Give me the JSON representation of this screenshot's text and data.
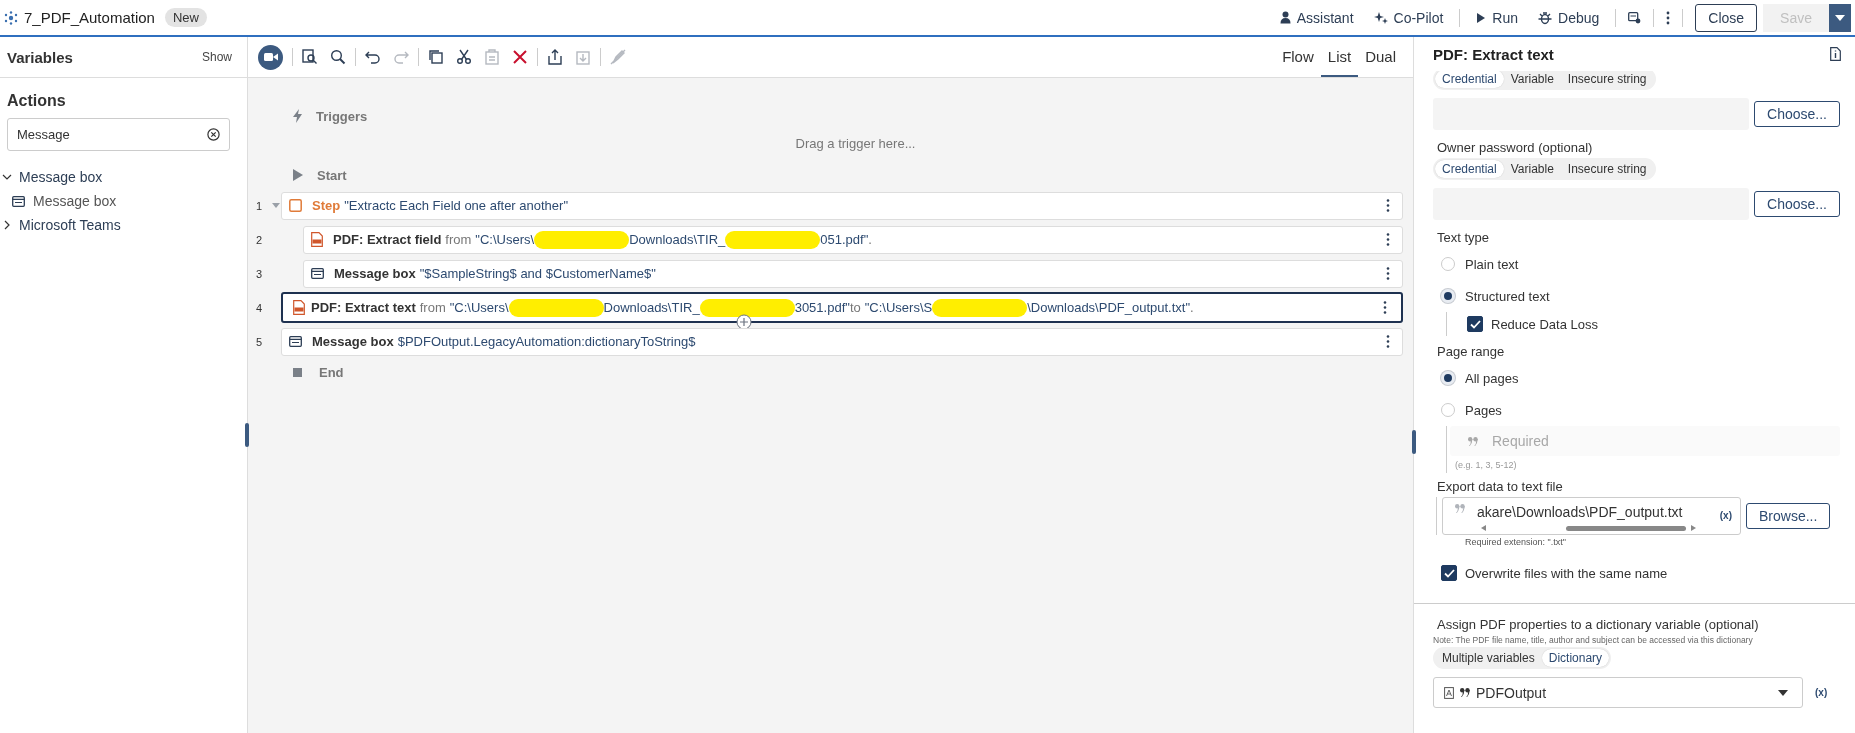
{
  "top_bar": {
    "title": "7_PDF_Automation",
    "badge": "New",
    "actions": [
      {
        "kind": "assistant",
        "label": "Assistant"
      },
      {
        "kind": "copilot",
        "label": "Co-Pilot"
      },
      {
        "kind": "run",
        "label": "Run"
      },
      {
        "kind": "debug",
        "label": "Debug"
      }
    ],
    "close": "Close",
    "save": {
      "label": "Save",
      "disabled": true
    }
  },
  "left_panel": {
    "variables": "Variables",
    "show": "Show",
    "actions_title": "Actions",
    "search": {
      "value": "Message"
    },
    "tree": [
      {
        "label": "Message box",
        "expanded": true,
        "children": [
          {
            "label": "Message box"
          }
        ]
      },
      {
        "label": "Microsoft Teams",
        "expanded": false
      }
    ]
  },
  "toolbar": {
    "tools": [
      {
        "kind": "record",
        "disabled": false
      },
      {
        "kind": "find",
        "disabled": false
      },
      {
        "kind": "search",
        "disabled": false
      },
      {
        "kind": "undo",
        "disabled": false
      },
      {
        "kind": "redo",
        "disabled": true
      },
      {
        "kind": "copy",
        "disabled": false
      },
      {
        "kind": "cut",
        "disabled": false
      },
      {
        "kind": "paste",
        "disabled": true
      },
      {
        "kind": "delete",
        "disabled": false
      },
      {
        "kind": "export",
        "disabled": false
      },
      {
        "kind": "import",
        "disabled": true
      },
      {
        "kind": "disable",
        "disabled": true
      }
    ],
    "views": [
      {
        "label": "Flow",
        "selected": false
      },
      {
        "label": "List",
        "selected": true
      },
      {
        "label": "Dual",
        "selected": false
      }
    ]
  },
  "flow": {
    "triggers": "Triggers",
    "drop_hint": "Drag a trigger here...",
    "start": "Start",
    "end": "End",
    "rows": [
      {
        "number": "1",
        "kind": "step",
        "selected": false,
        "expanded": true,
        "segments": [
          {
            "kind": "step",
            "text": "Step"
          },
          {
            "kind": "value",
            "text": "\"Extractc Each Field one after another\""
          }
        ],
        "children": [
          {
            "number": "2",
            "kind": "pdf",
            "selected": false,
            "segments": [
              {
                "kind": "name",
                "text": "PDF: Extract field"
              },
              {
                "kind": "plain",
                "text": "from"
              },
              {
                "kind": "value",
                "text": "\"C:\\Users\\"
              },
              {
                "kind": "redacted"
              },
              {
                "kind": "value",
                "text": "Downloads\\TIR_"
              },
              {
                "kind": "redacted"
              },
              {
                "kind": "value",
                "text": "051.pdf\""
              },
              {
                "kind": "plain",
                "text": "."
              }
            ]
          },
          {
            "number": "3",
            "kind": "message",
            "selected": false,
            "segments": [
              {
                "kind": "name",
                "text": "Message box"
              },
              {
                "kind": "value",
                "text": "\"$SampleString$ and $CustomerName$\""
              }
            ]
          }
        ]
      },
      {
        "number": "4",
        "kind": "pdf",
        "selected": true,
        "segments": [
          {
            "kind": "name",
            "text": "PDF: Extract text"
          },
          {
            "kind": "plain",
            "text": "from"
          },
          {
            "kind": "value",
            "text": "\"C:\\Users\\"
          },
          {
            "kind": "redacted"
          },
          {
            "kind": "value",
            "text": "Downloads\\TIR_"
          },
          {
            "kind": "redacted"
          },
          {
            "kind": "value",
            "text": "3051.pdf\""
          },
          {
            "kind": "plain",
            "text": "to"
          },
          {
            "kind": "value",
            "text": "\"C:\\Users\\S"
          },
          {
            "kind": "redacted"
          },
          {
            "kind": "value",
            "text": "\\Downloads\\PDF_output.txt\""
          },
          {
            "kind": "plain",
            "text": "."
          }
        ]
      },
      {
        "number": "5",
        "kind": "message",
        "selected": false,
        "segments": [
          {
            "kind": "name",
            "text": "Message box"
          },
          {
            "kind": "value",
            "text": "$PDFOutput.LegacyAutomation:dictionaryToString$"
          }
        ]
      }
    ]
  },
  "properties": {
    "title": "PDF: Extract text",
    "password_modes": [
      {
        "label": "Credential",
        "selected": true
      },
      {
        "label": "Variable",
        "selected": false
      },
      {
        "label": "Insecure string",
        "selected": false
      }
    ],
    "choose": "Choose...",
    "owner_password": {
      "label": "Owner password (optional)",
      "modes": [
        {
          "label": "Credential",
          "selected": true
        },
        {
          "label": "Variable",
          "selected": false
        },
        {
          "label": "Insecure string",
          "selected": false
        }
      ],
      "choose": "Choose..."
    },
    "text_type": {
      "label": "Text type",
      "options": [
        {
          "label": "Plain text",
          "selected": false
        },
        {
          "label": "Structured text",
          "selected": true,
          "sub_checkbox": {
            "label": "Reduce Data Loss",
            "checked": true
          }
        }
      ]
    },
    "page_range": {
      "label": "Page range",
      "options": [
        {
          "label": "All pages",
          "selected": true
        },
        {
          "label": "Pages",
          "selected": false
        }
      ],
      "pages_field": {
        "placeholder": "Required",
        "hint": "(e.g. 1, 3, 5-12)",
        "disabled": true
      }
    },
    "export": {
      "label": "Export data to text file",
      "value": "akare\\Downloads\\PDF_output.txt",
      "variable_button": "(x)",
      "hint": "Required extension: \".txt\"",
      "browse": "Browse..."
    },
    "overwrite": {
      "label": "Overwrite files with the same name",
      "checked": true
    },
    "assign": {
      "label": "Assign PDF properties to a dictionary variable (optional)",
      "note": "Note: The PDF file name, title, author and subject can be accessed via this dictionary",
      "modes": [
        {
          "label": "Multiple variables",
          "selected": false
        },
        {
          "label": "Dictionary",
          "selected": true
        }
      ],
      "value": "PDFOutput",
      "variable_button": "(x)"
    }
  }
}
